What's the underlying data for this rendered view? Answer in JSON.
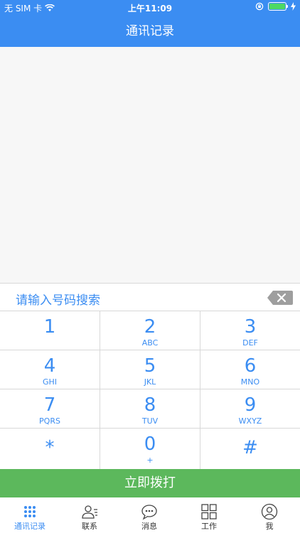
{
  "status_bar": {
    "carrier": "无 SIM 卡",
    "time": "上午11:09",
    "battery_level": 1.0,
    "colors": {
      "background": "#3b8df2",
      "battery_fill": "#4cd964"
    }
  },
  "header": {
    "title": "通讯记录"
  },
  "dialer": {
    "search_placeholder": "请输入号码搜索",
    "keys": [
      {
        "digit": "1",
        "letters": ""
      },
      {
        "digit": "2",
        "letters": "ABC"
      },
      {
        "digit": "3",
        "letters": "DEF"
      },
      {
        "digit": "4",
        "letters": "GHI"
      },
      {
        "digit": "5",
        "letters": "JKL"
      },
      {
        "digit": "6",
        "letters": "MNO"
      },
      {
        "digit": "7",
        "letters": "PQRS"
      },
      {
        "digit": "8",
        "letters": "TUV"
      },
      {
        "digit": "9",
        "letters": "WXYZ"
      },
      {
        "digit": "*",
        "letters": ""
      },
      {
        "digit": "0",
        "letters": "+"
      },
      {
        "digit": "#",
        "letters": ""
      }
    ],
    "call_button": "立即拨打"
  },
  "tab_bar": {
    "items": [
      {
        "label": "通讯记录",
        "icon": "dialpad-icon",
        "active": true
      },
      {
        "label": "联系",
        "icon": "contacts-icon",
        "active": false
      },
      {
        "label": "消息",
        "icon": "message-icon",
        "active": false
      },
      {
        "label": "工作",
        "icon": "grid-icon",
        "active": false
      },
      {
        "label": "我",
        "icon": "profile-icon",
        "active": false
      }
    ]
  },
  "colors": {
    "accent": "#3b8df2",
    "call_green": "#5cb85c",
    "background": "#f7f7f7"
  }
}
